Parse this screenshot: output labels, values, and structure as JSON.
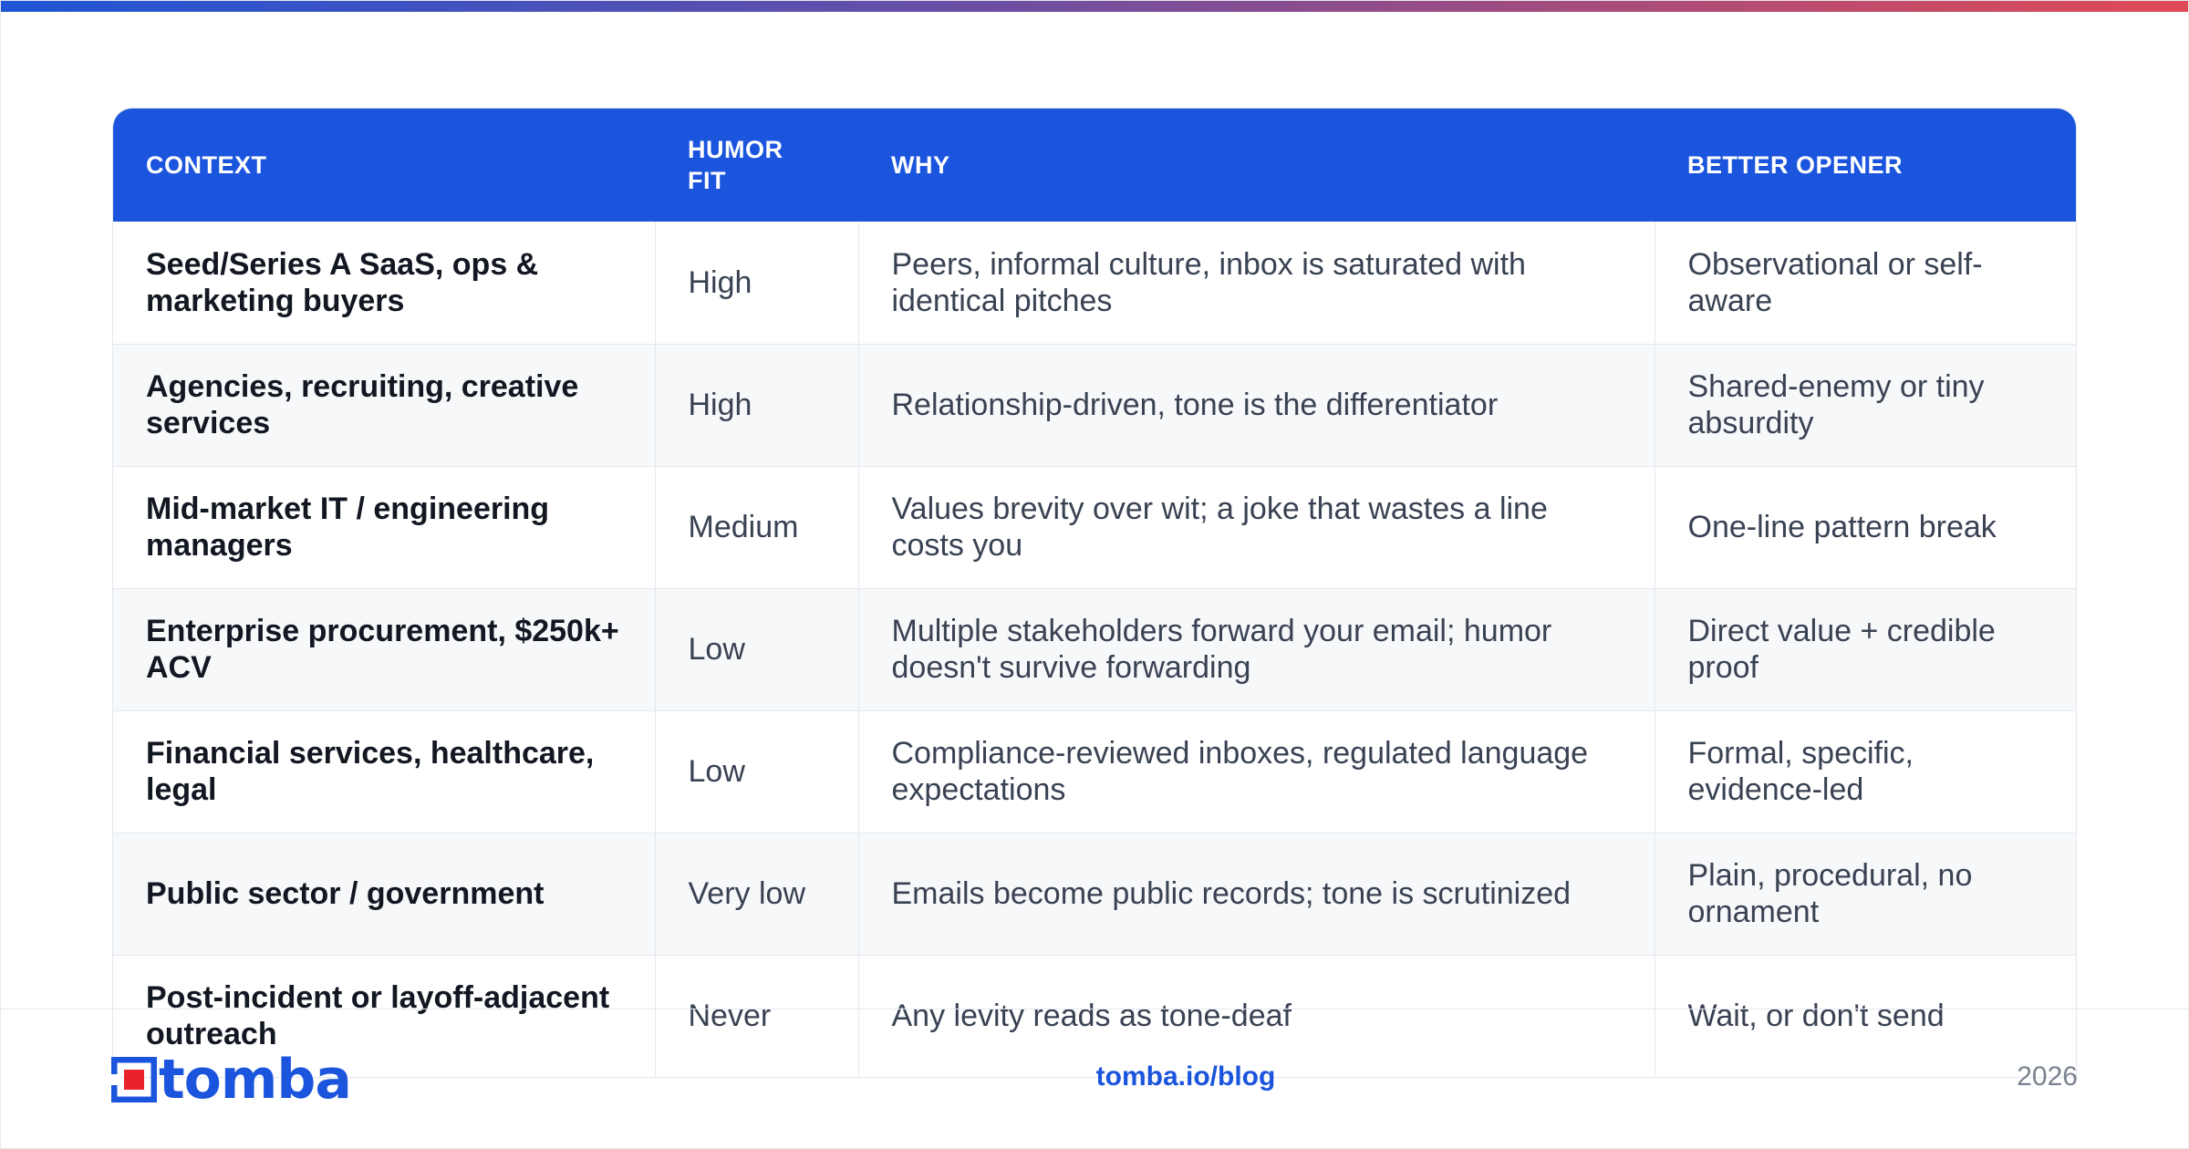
{
  "colors": {
    "accent": "#1b55dd",
    "gradient_end": "#e04a55",
    "logo_red": "#e8232b"
  },
  "table": {
    "headers": [
      "CONTEXT",
      "HUMOR FIT",
      "WHY",
      "BETTER OPENER"
    ],
    "rows": [
      {
        "context": "Seed/Series A SaaS, ops & marketing buyers",
        "fit": "High",
        "why": "Peers, informal culture, inbox is saturated with identical pitches",
        "opener": "Observational or self-aware"
      },
      {
        "context": "Agencies, recruiting, creative services",
        "fit": "High",
        "why": "Relationship-driven, tone is the differentiator",
        "opener": "Shared-enemy or tiny absurdity"
      },
      {
        "context": "Mid-market IT / engineering managers",
        "fit": "Medium",
        "why": "Values brevity over wit; a joke that wastes a line costs you",
        "opener": "One-line pattern break"
      },
      {
        "context": "Enterprise procurement, $250k+ ACV",
        "fit": "Low",
        "why": "Multiple stakeholders forward your email; humor doesn't survive forwarding",
        "opener": "Direct value + credible proof"
      },
      {
        "context": "Financial services, healthcare, legal",
        "fit": "Low",
        "why": "Compliance-reviewed inboxes, regulated language expectations",
        "opener": "Formal, specific, evidence-led"
      },
      {
        "context": "Public sector / government",
        "fit": "Very low",
        "why": "Emails become public records; tone is scrutinized",
        "opener": "Plain, procedural, no ornament"
      },
      {
        "context": "Post-incident or layoff-adjacent outreach",
        "fit": "Never",
        "why": "Any levity reads as tone-deaf",
        "opener": "Wait, or don't send"
      }
    ]
  },
  "footer": {
    "logo_text": "tomba",
    "logo_icon": "tomba-logo-icon",
    "link": "tomba.io/blog",
    "year": "2026"
  }
}
